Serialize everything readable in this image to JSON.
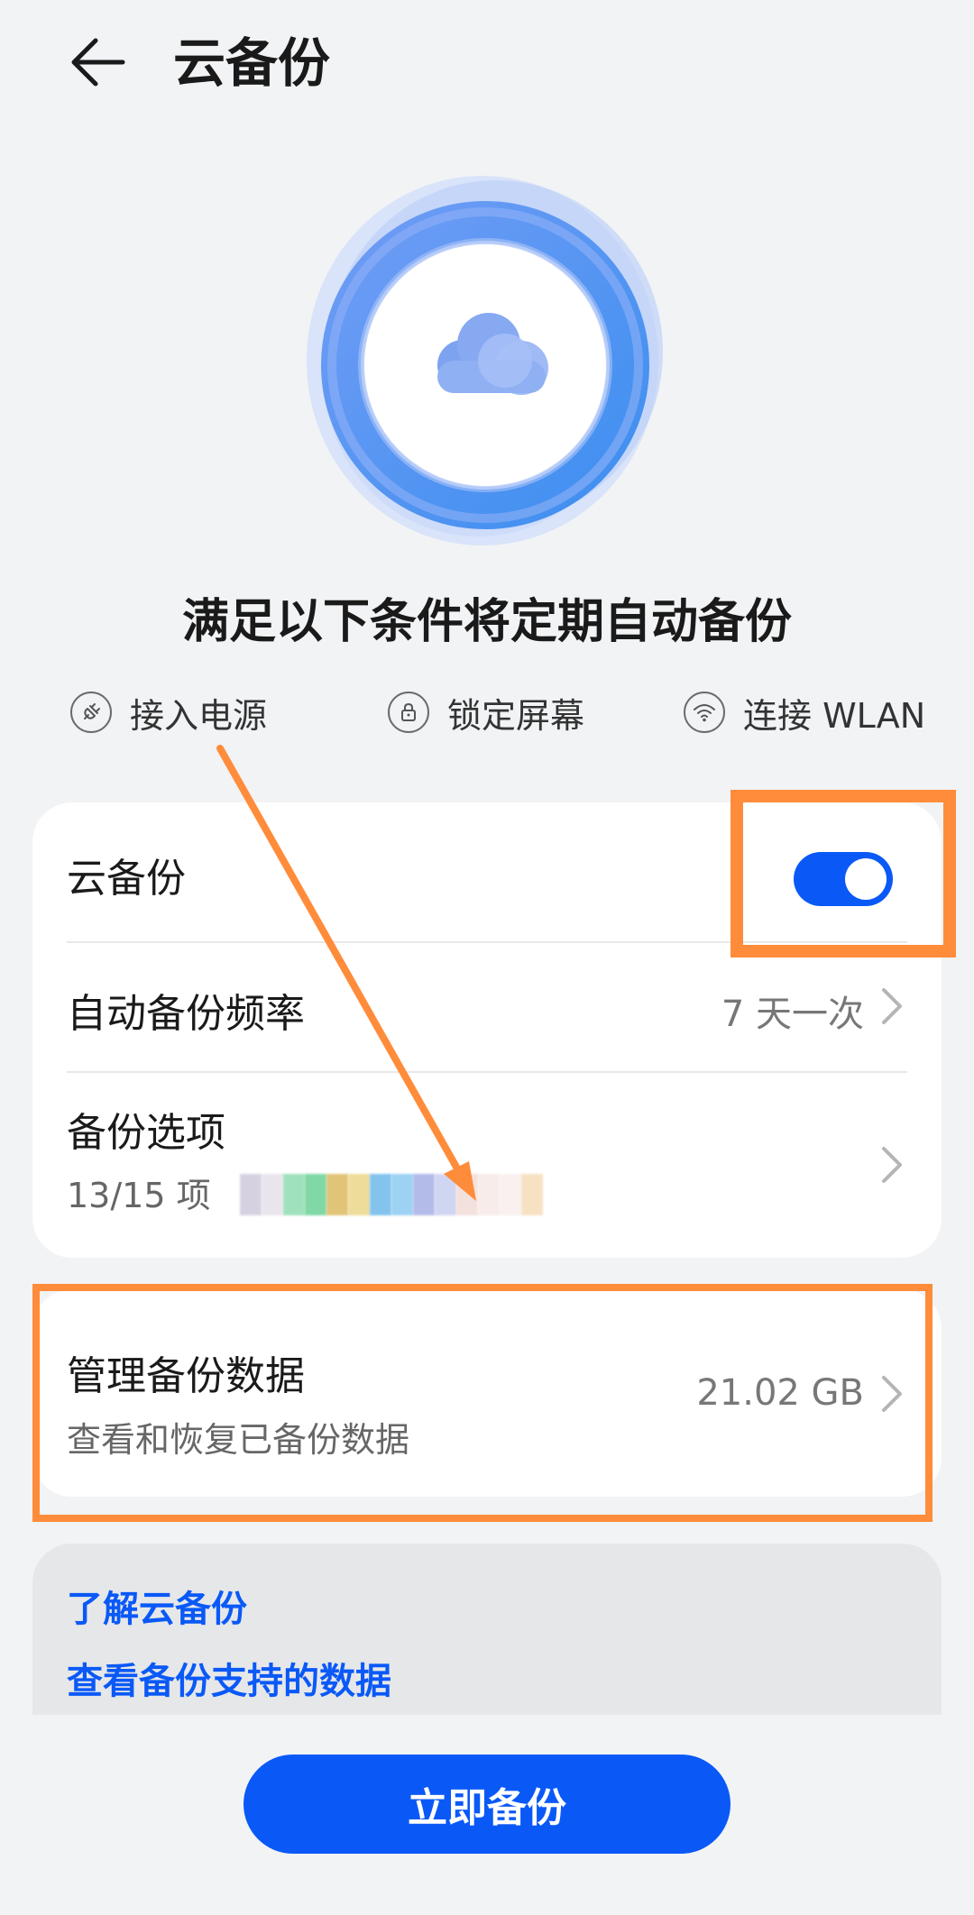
{
  "header": {
    "title": "云备份"
  },
  "hero": {
    "subtitle": "满足以下条件将定期自动备份"
  },
  "conditions": [
    {
      "label": "接入电源",
      "icon": "plug-icon"
    },
    {
      "label": "锁定屏幕",
      "icon": "lock-icon"
    },
    {
      "label": "连接 WLAN",
      "icon": "wifi-icon"
    }
  ],
  "settings": {
    "cloud_backup_label": "云备份",
    "cloud_backup_enabled": true,
    "frequency_label": "自动备份频率",
    "frequency_value": "7 天一次",
    "options_label": "备份选项",
    "options_summary": "13/15 项"
  },
  "manage": {
    "label": "管理备份数据",
    "sub": "查看和恢复已备份数据",
    "size": "21.02 GB"
  },
  "links": {
    "learn": "了解云备份",
    "supported": "查看备份支持的数据"
  },
  "actions": {
    "backup_now": "立即备份"
  },
  "colors": {
    "accent": "#0a59f7",
    "highlight": "#ff8c3a",
    "background": "#f1f3f5"
  }
}
